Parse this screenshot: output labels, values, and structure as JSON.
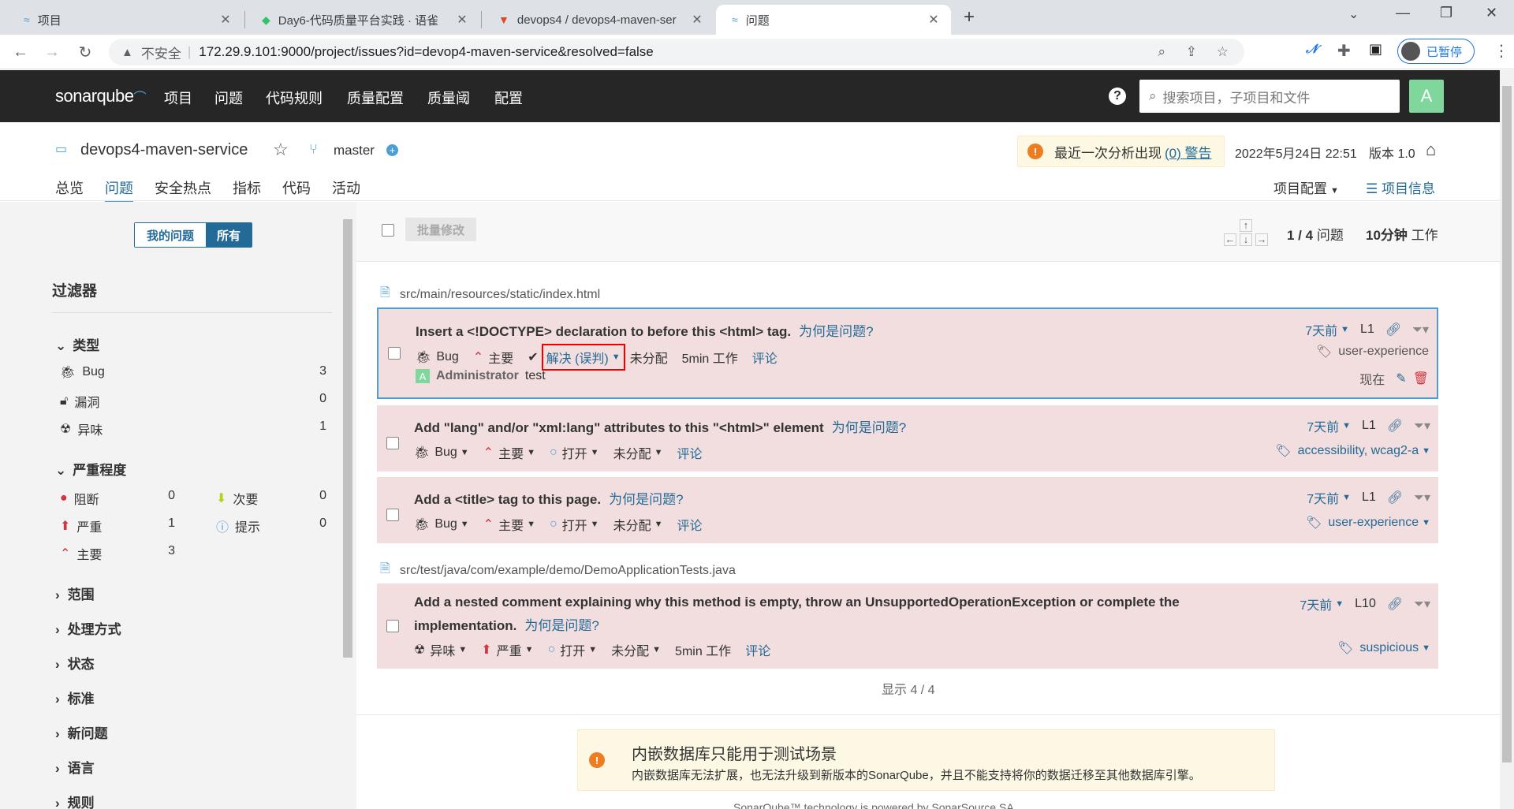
{
  "browser": {
    "tabs": [
      {
        "title": "项目"
      },
      {
        "title": "Day6-代码质量平台实践 · 语雀"
      },
      {
        "title": "devops4 / devops4-maven-ser"
      },
      {
        "title": "问题"
      }
    ],
    "url": "172.29.9.101:9000/project/issues?id=devop4-maven-service&resolved=false",
    "insecure_label": "不安全",
    "profile_label": "已暂停"
  },
  "nav": {
    "logo": "sonarqube",
    "items": [
      "项目",
      "问题",
      "代码规则",
      "质量配置",
      "质量阈",
      "配置"
    ],
    "search_placeholder": "搜索项目，子项目和文件",
    "avatar": "A"
  },
  "project": {
    "name": "devops4-maven-service",
    "branch": "master",
    "warning_prefix": "最近一次分析出现",
    "warning_link": "(0) 警告",
    "date": "2022年5月24日 22:51",
    "version": "版本 1.0",
    "tabs": [
      "总览",
      "问题",
      "安全热点",
      "指标",
      "代码",
      "活动"
    ],
    "settings_label": "项目配置",
    "info_label": "项目信息"
  },
  "sidebar": {
    "toggle": {
      "mine": "我的问题",
      "all": "所有"
    },
    "title": "过滤器",
    "type_title": "类型",
    "types": [
      {
        "label": "Bug",
        "count": "3"
      },
      {
        "label": "漏洞",
        "count": "0"
      },
      {
        "label": "异味",
        "count": "1"
      }
    ],
    "severity_title": "严重程度",
    "severities": [
      {
        "label": "阻断",
        "count": "0"
      },
      {
        "label": "次要",
        "count": "0"
      },
      {
        "label": "严重",
        "count": "1"
      },
      {
        "label": "提示",
        "count": "0"
      },
      {
        "label": "主要",
        "count": "3"
      }
    ],
    "collapsed": [
      "范围",
      "处理方式",
      "状态",
      "标准",
      "新问题",
      "语言",
      "规则"
    ]
  },
  "toolbar": {
    "bulk": "批量修改",
    "count": "1 / 4",
    "count_unit": "问题",
    "effort": "10分钟",
    "effort_unit": "工作"
  },
  "files": [
    "src/main/resources/static/index.html",
    "src/test/java/com/example/demo/DemoApplicationTests.java"
  ],
  "issues": [
    {
      "message": "Insert a <!DOCTYPE> declaration to before this <html> tag.",
      "why": "为何是问题?",
      "type": "Bug",
      "severity": "主要",
      "status": "解决 (误判)",
      "assignee": "未分配",
      "effort": "5min 工作",
      "comment": "评论",
      "age": "7天前",
      "line": "L1",
      "tags": "user-experience",
      "comment_author": "Administrator",
      "comment_text": "test",
      "comment_time": "现在"
    },
    {
      "message": "Add \"lang\" and/or \"xml:lang\" attributes to this \"<html>\" element",
      "why": "为何是问题?",
      "type": "Bug",
      "severity": "主要",
      "status": "打开",
      "assignee": "未分配",
      "comment": "评论",
      "age": "7天前",
      "line": "L1",
      "tags": "accessibility, wcag2-a"
    },
    {
      "message": "Add a <title> tag to this page.",
      "why": "为何是问题?",
      "type": "Bug",
      "severity": "主要",
      "status": "打开",
      "assignee": "未分配",
      "comment": "评论",
      "age": "7天前",
      "line": "L1",
      "tags": "user-experience"
    },
    {
      "message_line1": "Add a nested comment explaining why this method is empty, throw an UnsupportedOperationException or complete the",
      "message_line2": "implementation.",
      "why": "为何是问题?",
      "type": "异味",
      "severity": "严重",
      "status": "打开",
      "assignee": "未分配",
      "effort": "5min 工作",
      "comment": "评论",
      "age": "7天前",
      "line": "L10",
      "tags": "suspicious"
    }
  ],
  "shown": "显示 4 / 4",
  "footer_warning": {
    "title": "内嵌数据库只能用于测试场景",
    "text": "内嵌数据库无法扩展，也无法升级到新版本的SonarQube，并且不能支持将你的数据迁移至其他数据库引擎。"
  },
  "footer_text": "SonarQube™ technology is powered by SonarSource SA",
  "colors": {
    "accent": "#236a97",
    "issue_bg": "#f2dede",
    "header": "#262626",
    "blocker": "#d4333f",
    "minor": "#b0d513",
    "info": "#4b9fd5"
  }
}
